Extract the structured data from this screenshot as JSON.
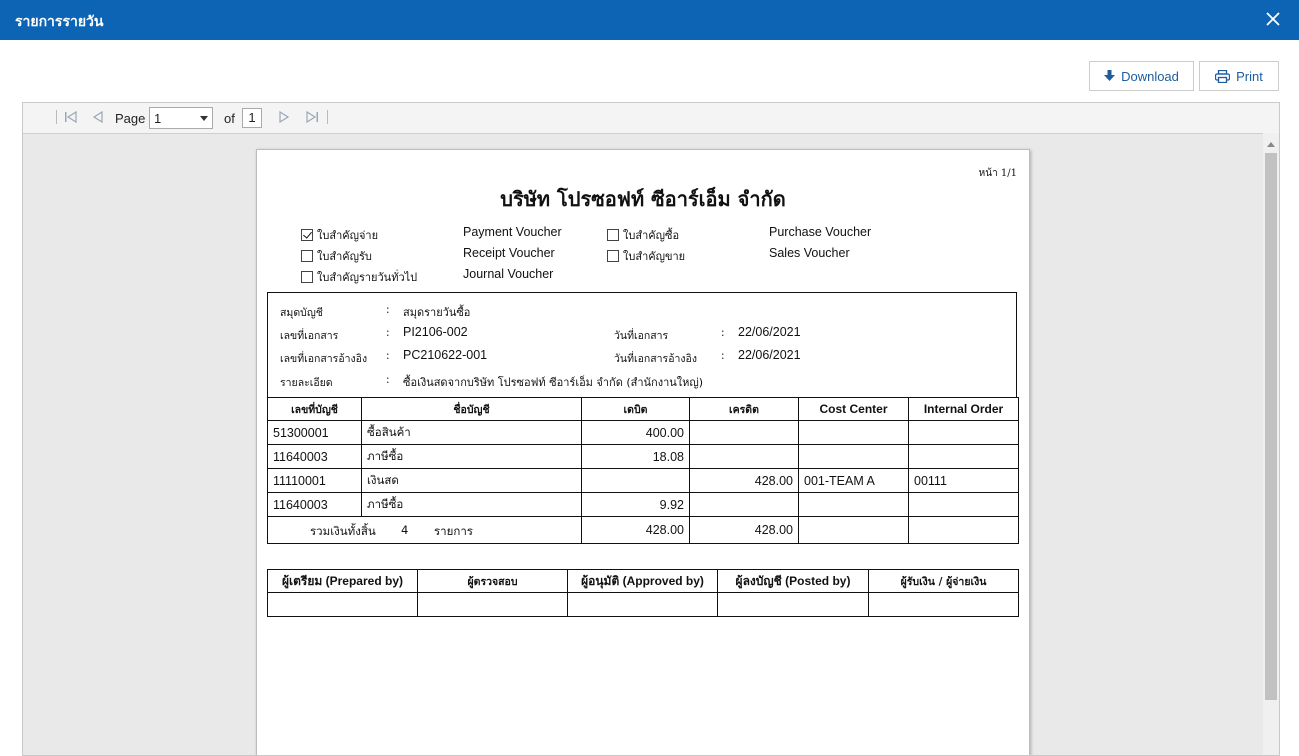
{
  "window": {
    "title": "รายการรายวัน",
    "close_icon": "close-icon"
  },
  "actions": {
    "download_label": "Download",
    "print_label": "Print"
  },
  "toolbar": {
    "page_label": "Page",
    "page_value": "1",
    "of_label": "of",
    "page_total": "1"
  },
  "report": {
    "page_indicator": "หน้า 1/1",
    "company": "บริษัท โปรซอฟท์ ซีอาร์เอ็ม จำกัด",
    "voucher_types": [
      {
        "thai": "ใบสำคัญจ่าย",
        "english": "Payment Voucher",
        "checked": true
      },
      {
        "thai": "ใบสำคัญรับ",
        "english": "Receipt Voucher",
        "checked": false
      },
      {
        "thai": "ใบสำคัญรายวันทั่วไป",
        "english": "Journal Voucher",
        "checked": false
      },
      {
        "thai": "ใบสำคัญซื้อ",
        "english": "Purchase Voucher",
        "checked": false
      },
      {
        "thai": "ใบสำคัญขาย",
        "english": "Sales Voucher",
        "checked": false
      }
    ],
    "info": {
      "book_label": "สมุดบัญชี",
      "book_value": "สมุดรายวันซื้อ",
      "docno_label": "เลขที่เอกสาร",
      "docno_value": "PI2106-002",
      "docdate_label": "วันที่เอกสาร",
      "docdate_value": "22/06/2021",
      "refno_label": "เลขที่เอกสารอ้างอิง",
      "refno_value": "PC210622-001",
      "refdate_label": "วันที่เอกสารอ้างอิง",
      "refdate_value": "22/06/2021",
      "desc_label": "รายละเอียด",
      "desc_value": "ซื้อเงินสดจากบริษัท โปรซอฟท์ ซีอาร์เอ็ม จำกัด (สำนักงานใหญ่)",
      "colon": ":"
    },
    "table": {
      "headers": [
        "เลขที่บัญชี",
        "ชื่อบัญชี",
        "เดบิต",
        "เครดิต",
        "Cost Center",
        "Internal Order"
      ],
      "rows": [
        [
          "51300001",
          "ซื้อสินค้า",
          "400.00",
          "",
          "",
          ""
        ],
        [
          "11640003",
          "ภาษีซื้อ",
          "18.08",
          "",
          "",
          ""
        ],
        [
          "11110001",
          "เงินสด",
          "",
          "428.00",
          "001-TEAM A",
          "00111"
        ],
        [
          "11640003",
          "ภาษีซื้อ",
          "9.92",
          "",
          "",
          ""
        ]
      ],
      "total_label": "รวมเงินทั้งสิ้น",
      "total_count": "4",
      "total_unit": "รายการ",
      "total_debit": "428.00",
      "total_credit": "428.00"
    },
    "signatures": [
      "ผู้เตรียม (Prepared by)",
      "ผู้ตรวจสอบ",
      "ผู้อนุมัติ (Approved by)",
      "ผู้ลงบัญชี (Posted by)",
      "ผู้รับเงิน / ผู้จ่ายเงิน"
    ]
  }
}
